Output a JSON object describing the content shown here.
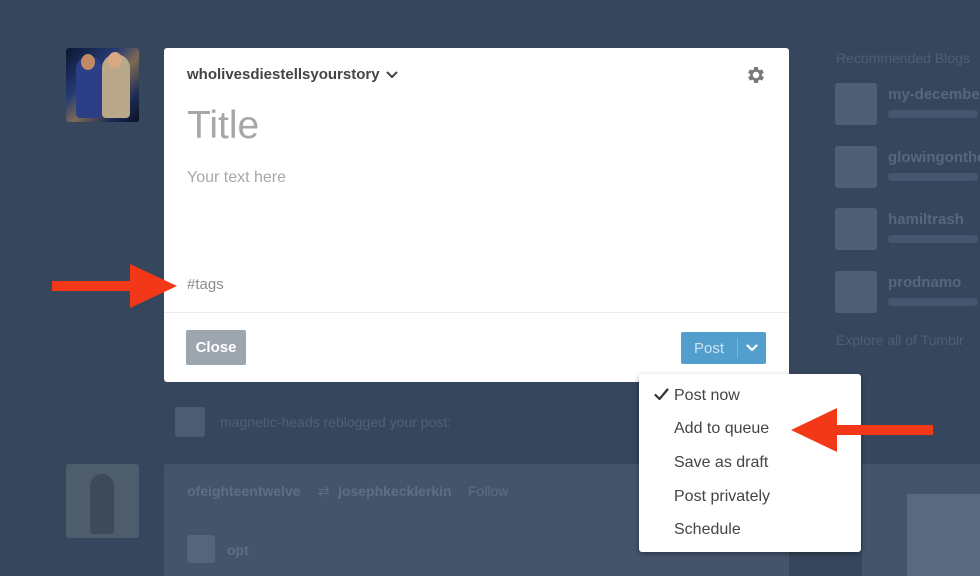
{
  "modal": {
    "blog_name": "wholivesdiestellsyourstory",
    "title_placeholder": "Title",
    "body_placeholder": "Your text here",
    "tags_placeholder": "#tags",
    "close_label": "Close",
    "post_label": "Post"
  },
  "post_menu": {
    "selected": "Post now",
    "items": [
      {
        "label": "Post now"
      },
      {
        "label": "Add to queue"
      },
      {
        "label": "Save as draft"
      },
      {
        "label": "Post privately"
      },
      {
        "label": "Schedule"
      }
    ]
  },
  "background": {
    "card_blog": "ofeighteentwelve",
    "card_reblogged_from": "josephkecklerkin",
    "card_follow": "Follow",
    "card_text": "opt",
    "notice": "magnetic-heads reblogged your post:",
    "right_heading": "Recommended Blogs",
    "right_blogs": [
      "my-december",
      "glowingonthe",
      "hamiltrash",
      "prodnamo"
    ],
    "right_footer": "Explore all of Tumblr"
  },
  "colors": {
    "background": "#36465d",
    "post_button": "#529ecc",
    "close_button": "#9da6af",
    "annotation_arrow": "#f23818"
  }
}
